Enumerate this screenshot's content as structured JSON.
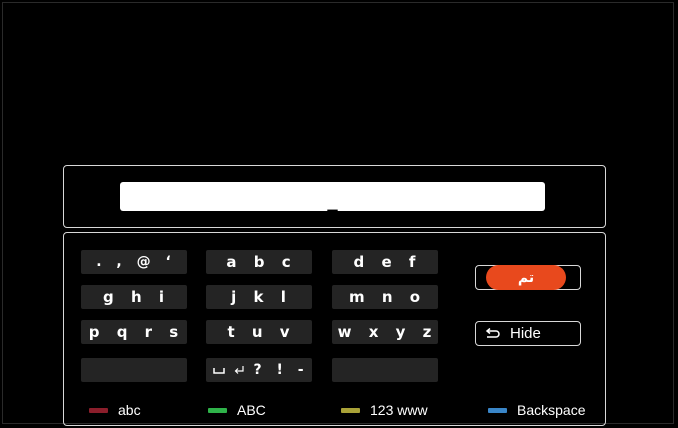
{
  "input": {
    "value": "_"
  },
  "keyboard": {
    "rows": [
      [
        "., @ ‘",
        "a  b  c",
        "d  e  f"
      ],
      [
        "g  h  i",
        "j  k  l",
        "m  n  o"
      ],
      [
        "p q r s",
        "t  u  v",
        "w x y z"
      ],
      [
        "",
        "␣ ↵ ? ! -",
        ""
      ]
    ],
    "row1": {
      "key1": ". ,  @  ‘",
      "key2": "a  b  c",
      "key3": "d  e  f"
    },
    "row2": {
      "key1": "g  h  i",
      "key2": "j  k  l",
      "key3": "m  n  o"
    },
    "row3": {
      "key1": "p  q  r  s",
      "key2": "t  u  v",
      "key3": "w  x  y  z"
    },
    "row4": {
      "key1": "",
      "key2": "? ! -",
      "key3": ""
    }
  },
  "actions": {
    "done_label": "تم",
    "hide_label": "Hide"
  },
  "legend": {
    "red": {
      "label": "abc",
      "color": "#8b1e2b"
    },
    "green": {
      "label": "ABC",
      "color": "#2fb34a"
    },
    "yellow": {
      "label": "123 www",
      "color": "#a9a238"
    },
    "blue": {
      "label": "Backspace",
      "color": "#3a86c8"
    }
  },
  "colors": {
    "accent": "#e8491d",
    "key_background": "#242424",
    "background": "#000000"
  }
}
